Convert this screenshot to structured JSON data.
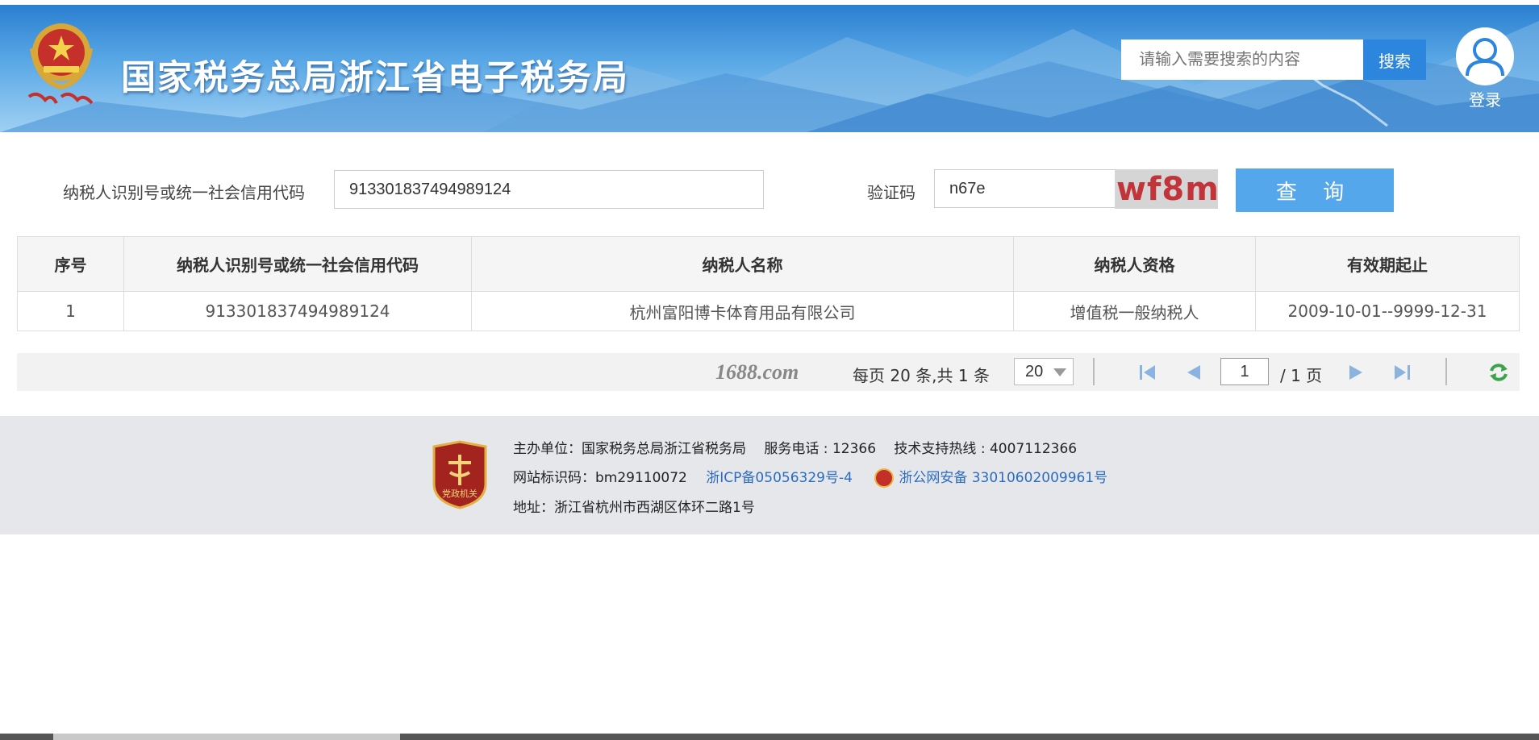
{
  "header": {
    "site_title": "国家税务总局浙江省电子税务局",
    "search_placeholder": "请输入需要搜索的内容",
    "search_button": "搜索",
    "login_label": "登录"
  },
  "query_form": {
    "taxpayer_id_label": "纳税人识别号或统一社会信用代码",
    "taxpayer_id_value": "913301837494989124",
    "captcha_label": "验证码",
    "captcha_input_value": "n67e",
    "captcha_image_text": "wf8m",
    "query_button": "查 询"
  },
  "results_table": {
    "columns": [
      "序号",
      "纳税人识别号或统一社会信用代码",
      "纳税人名称",
      "纳税人资格",
      "有效期起止"
    ],
    "rows": [
      [
        "1",
        "913301837494989124",
        "杭州富阳博卡体育用品有限公司",
        "增值税一般纳税人",
        "2009-10-01--9999-12-31"
      ]
    ]
  },
  "pagination": {
    "watermark": "1688.com",
    "info": "每页 20 条,共 1 条",
    "page_size": "20",
    "current_page": "1",
    "total_pages": "/ 1 页"
  },
  "footer": {
    "host_line": "主办单位：国家税务总局浙江省税务局　 服务电话 : 12366　 技术支持热线 : 4007112366",
    "site_id": "网站标识码：bm29110072",
    "icp": "浙ICP备05056329号-4",
    "police_record": "浙公网安备 33010602009961号",
    "address": "地址：浙江省杭州市西湖区体环二路1号",
    "badge_text": "党政机关"
  },
  "colors": {
    "header_blue": "#2a7fd0",
    "button_blue": "#2d86dd",
    "query_button": "#55a7ec",
    "link": "#2a6cc0",
    "captcha_text": "#c0343a"
  }
}
